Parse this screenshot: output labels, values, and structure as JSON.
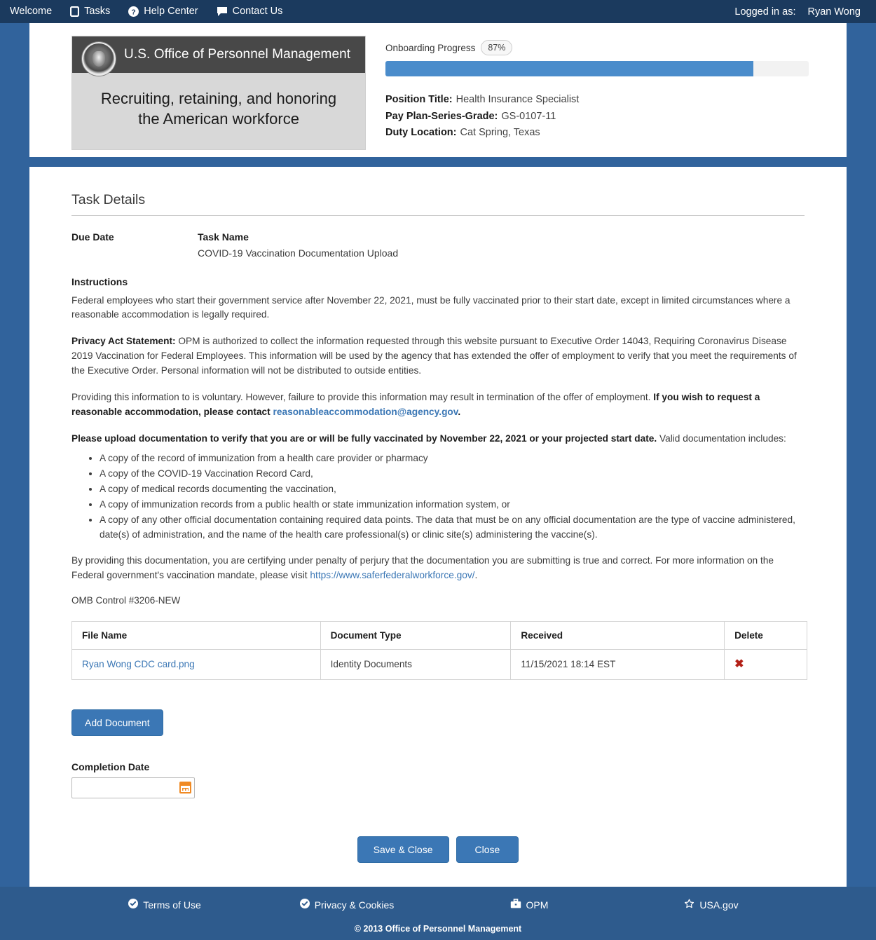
{
  "topnav": {
    "items": [
      {
        "label": "Welcome",
        "icon": ""
      },
      {
        "label": "Tasks",
        "icon": "square-outline-icon"
      },
      {
        "label": "Help Center",
        "icon": "question-circle-icon"
      },
      {
        "label": "Contact Us",
        "icon": "comment-icon"
      }
    ],
    "logged_in_label": "Logged in as:",
    "user_name": "Ryan Wong"
  },
  "branding": {
    "agency_name": "U.S. Office of Personnel Management",
    "tagline_line1": "Recruiting, retaining, and honoring",
    "tagline_line2": "the American workforce",
    "seal_alt": "opm-seal-icon"
  },
  "progress": {
    "label": "Onboarding Progress",
    "percent_label": "87%",
    "percent": 87,
    "bar_color": "#4a8ccb"
  },
  "position": {
    "title_label": "Position Title:",
    "title_value": "Health Insurance Specialist",
    "payplan_label": "Pay Plan-Series-Grade:",
    "payplan_value": "GS-0107-11",
    "duty_label": "Duty Location:",
    "duty_value": "Cat Spring, Texas"
  },
  "task": {
    "section_title": "Task Details",
    "due_date_label": "Due Date",
    "due_date_value": "",
    "task_name_label": "Task Name",
    "task_name_value": "COVID-19 Vaccination Documentation Upload",
    "instructions_label": "Instructions",
    "para1": "Federal employees who start their government service after November 22, 2021, must be fully vaccinated prior to their start date, except in limited circumstances where a reasonable accommodation is legally required.",
    "privacy_label": "Privacy Act Statement:",
    "privacy_text": " OPM is authorized to collect the information requested through this website pursuant to Executive Order 14043, Requiring Coronavirus Disease 2019 Vaccination for Federal Employees. This information will be used by the agency that has extended the offer of employment to verify that you meet the requirements of the Executive Order. Personal information will not be distributed to outside entities.",
    "voluntary_text": "Providing this information to is voluntary. However, failure to provide this information may result in termination of the offer of employment. ",
    "accommodation_bold": "If you wish to request a reasonable accommodation, please contact ",
    "accommodation_email": "reasonableaccommodation@agency.gov",
    "accommodation_period": ".",
    "upload_bold": "Please upload documentation to verify that you are or will be fully vaccinated by November 22, 2021 or your projected start date.",
    "upload_rest": " Valid documentation includes:",
    "doc_list": [
      "A copy of the record of immunization from a health care provider or pharmacy",
      "A copy of the COVID-19 Vaccination Record Card,",
      "A copy of medical records documenting the vaccination,",
      "A copy of immunization records from a public health or state immunization information system, or",
      "A copy of any other official documentation containing required data points. The data that must be on any official documentation are the type of vaccine administered, date(s) of administration, and the name of the health care professional(s) or clinic site(s) administering the vaccine(s)."
    ],
    "certify_text": "By providing this documentation, you are certifying under penalty of perjury that the documentation you are submitting is true and correct. For more information on the Federal government's vaccination mandate, please visit ",
    "certify_link": "https://www.saferfederalworkforce.gov/",
    "certify_period": ".",
    "omb": "OMB Control #3206-NEW"
  },
  "documents_table": {
    "columns": [
      "File Name",
      "Document Type",
      "Received",
      "Delete"
    ],
    "rows": [
      {
        "file_name": "Ryan Wong CDC card.png",
        "document_type": "Identity Documents",
        "received": "11/15/2021 18:14 EST",
        "delete_icon": "delete-x-icon"
      }
    ]
  },
  "controls": {
    "add_document_label": "Add Document",
    "completion_date_label": "Completion Date",
    "completion_date_value": "",
    "completion_date_placeholder": "",
    "calendar_icon": "calendar-icon",
    "save_close_label": "Save & Close",
    "close_label": "Close"
  },
  "footer": {
    "links": [
      {
        "label": "Terms of Use",
        "icon": "check-circle-icon"
      },
      {
        "label": "Privacy & Cookies",
        "icon": "check-circle-icon"
      },
      {
        "label": "OPM",
        "icon": "briefcase-icon"
      },
      {
        "label": "USA.gov",
        "icon": "star-icon"
      }
    ],
    "copyright": "© 2013 Office of Personnel Management"
  }
}
